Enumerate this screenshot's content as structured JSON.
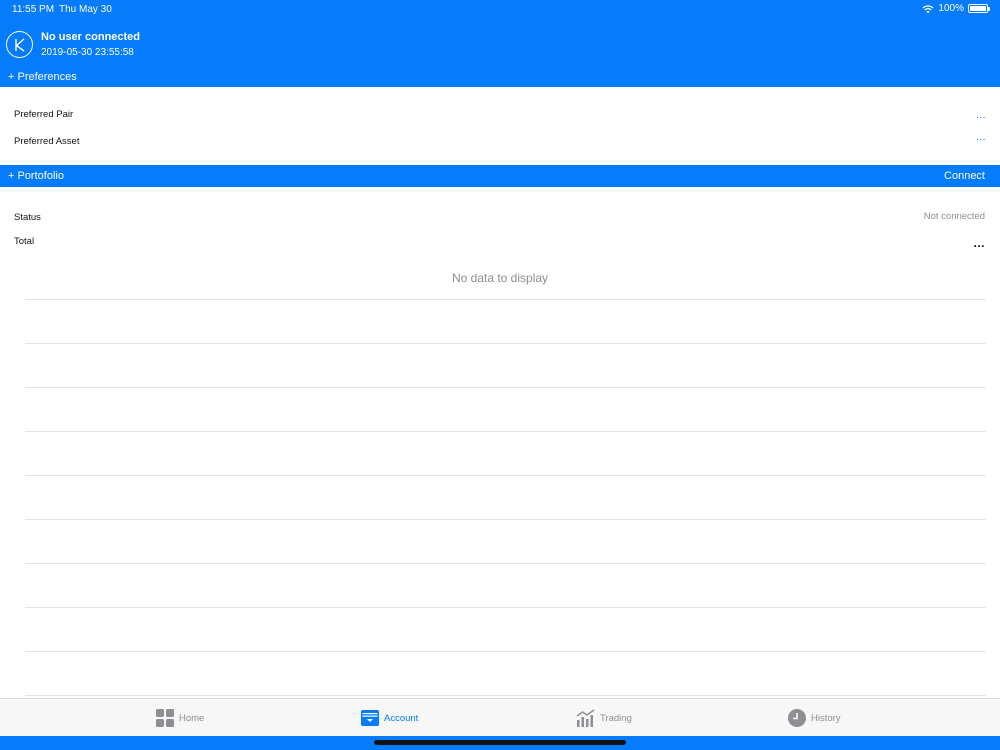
{
  "status_bar": {
    "time": "11:55 PM",
    "date": "Thu May 30",
    "battery": "100%"
  },
  "header": {
    "user_name": "No user connected",
    "timestamp": "2019-05-30 23:55:58",
    "preferences_toggle": "+ Preferences"
  },
  "preferences": {
    "rows": [
      {
        "label": "Preferred Pair",
        "action": "..."
      },
      {
        "label": "Preferred Asset",
        "action": "..."
      }
    ]
  },
  "portfolio": {
    "title": "+ Portofolio",
    "connect_label": "Connect",
    "status_label": "Status",
    "status_value": "Not connected",
    "total_label": "Total",
    "total_action": "...",
    "empty_message": "No data to display"
  },
  "tabs": [
    {
      "label": "Home",
      "icon": "grid-icon",
      "active": false
    },
    {
      "label": "Account",
      "icon": "wallet-icon",
      "active": true
    },
    {
      "label": "Trading",
      "icon": "chart-icon",
      "active": false
    },
    {
      "label": "History",
      "icon": "clock-icon",
      "active": false
    }
  ],
  "colors": {
    "accent": "#057bfd",
    "muted_text": "#8e8e93"
  }
}
